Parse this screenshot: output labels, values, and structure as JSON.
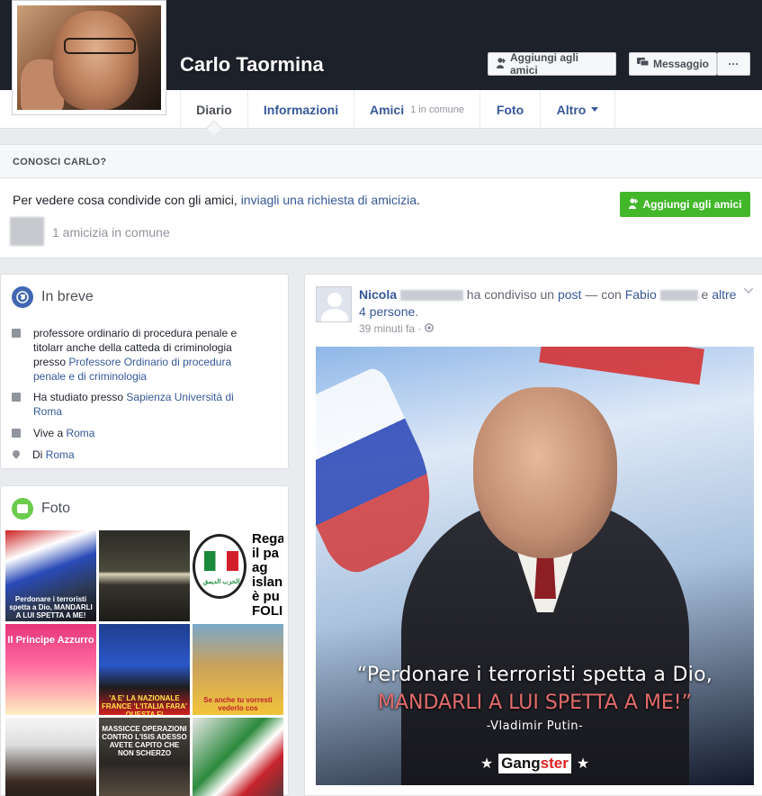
{
  "profile": {
    "name": "Carlo Taormina",
    "add_friend_label": "Aggiungi agli amici",
    "message_label": "Messaggio",
    "more_label": "···"
  },
  "tabs": [
    {
      "label": "Diario"
    },
    {
      "label": "Informazioni"
    },
    {
      "label": "Amici",
      "sub": "1 in comune"
    },
    {
      "label": "Foto"
    },
    {
      "label": "Altro"
    }
  ],
  "conosci": {
    "heading": "CONOSCI CARLO?",
    "text_prefix": "Per vedere cosa condivide con gli amici, ",
    "text_link": "inviagli una richiesta di amicizia",
    "text_suffix": ".",
    "button_label": "Aggiungi agli amici",
    "mutual": "1 amicizia in comune"
  },
  "inbreve": {
    "title": "In breve",
    "work_text": "professore ordinario di procedura penale e titolarr anche della catteda di criminologia presso ",
    "work_link": "Professore Ordinario di procedura penale e di criminologia",
    "study_prefix": "Ha studiato presso ",
    "study_link": "Sapienza Università di Roma",
    "lives_prefix": "Vive a ",
    "lives_link": "Roma",
    "from_prefix": "Di ",
    "from_link": "Roma"
  },
  "foto": {
    "title": "Foto",
    "tile_captions": {
      "t1": "Perdonare i terroristi spetta a Dio, MANDARLI A LUI SPETTA A ME!",
      "t3_big": "Rega il pa ag islan è pu FOLI",
      "t3_arabic": "الحزب الديمق",
      "t4": "Il Principe Azzurro",
      "t5": "'A E' LA NAZIONALE FRANCE 'L'ITALIA FARA' QUESTA FI",
      "t6": "Se anche tu vorresti vederlo cos",
      "t8": "MASSICCE OPERAZIONI CONTRO L'ISIS ADESSO AVETE CAPITO CHE NON SCHERZO"
    }
  },
  "post": {
    "author": "Nicola",
    "action": " ha condiviso un ",
    "object_link": "post",
    "with": " — con ",
    "tagged": "Fabio",
    "and": " e ",
    "others_link": "altre 4 persone",
    "period": ".",
    "time": "39 minuti fa ·",
    "quote_line1": "“Perdonare i terroristi spetta a Dio,",
    "quote_line2": "MANDARLI A LUI SPETTA A ME!”",
    "quote_author": "-Vladimir Putin-",
    "brand_left": "Gang",
    "brand_right": "ster"
  }
}
